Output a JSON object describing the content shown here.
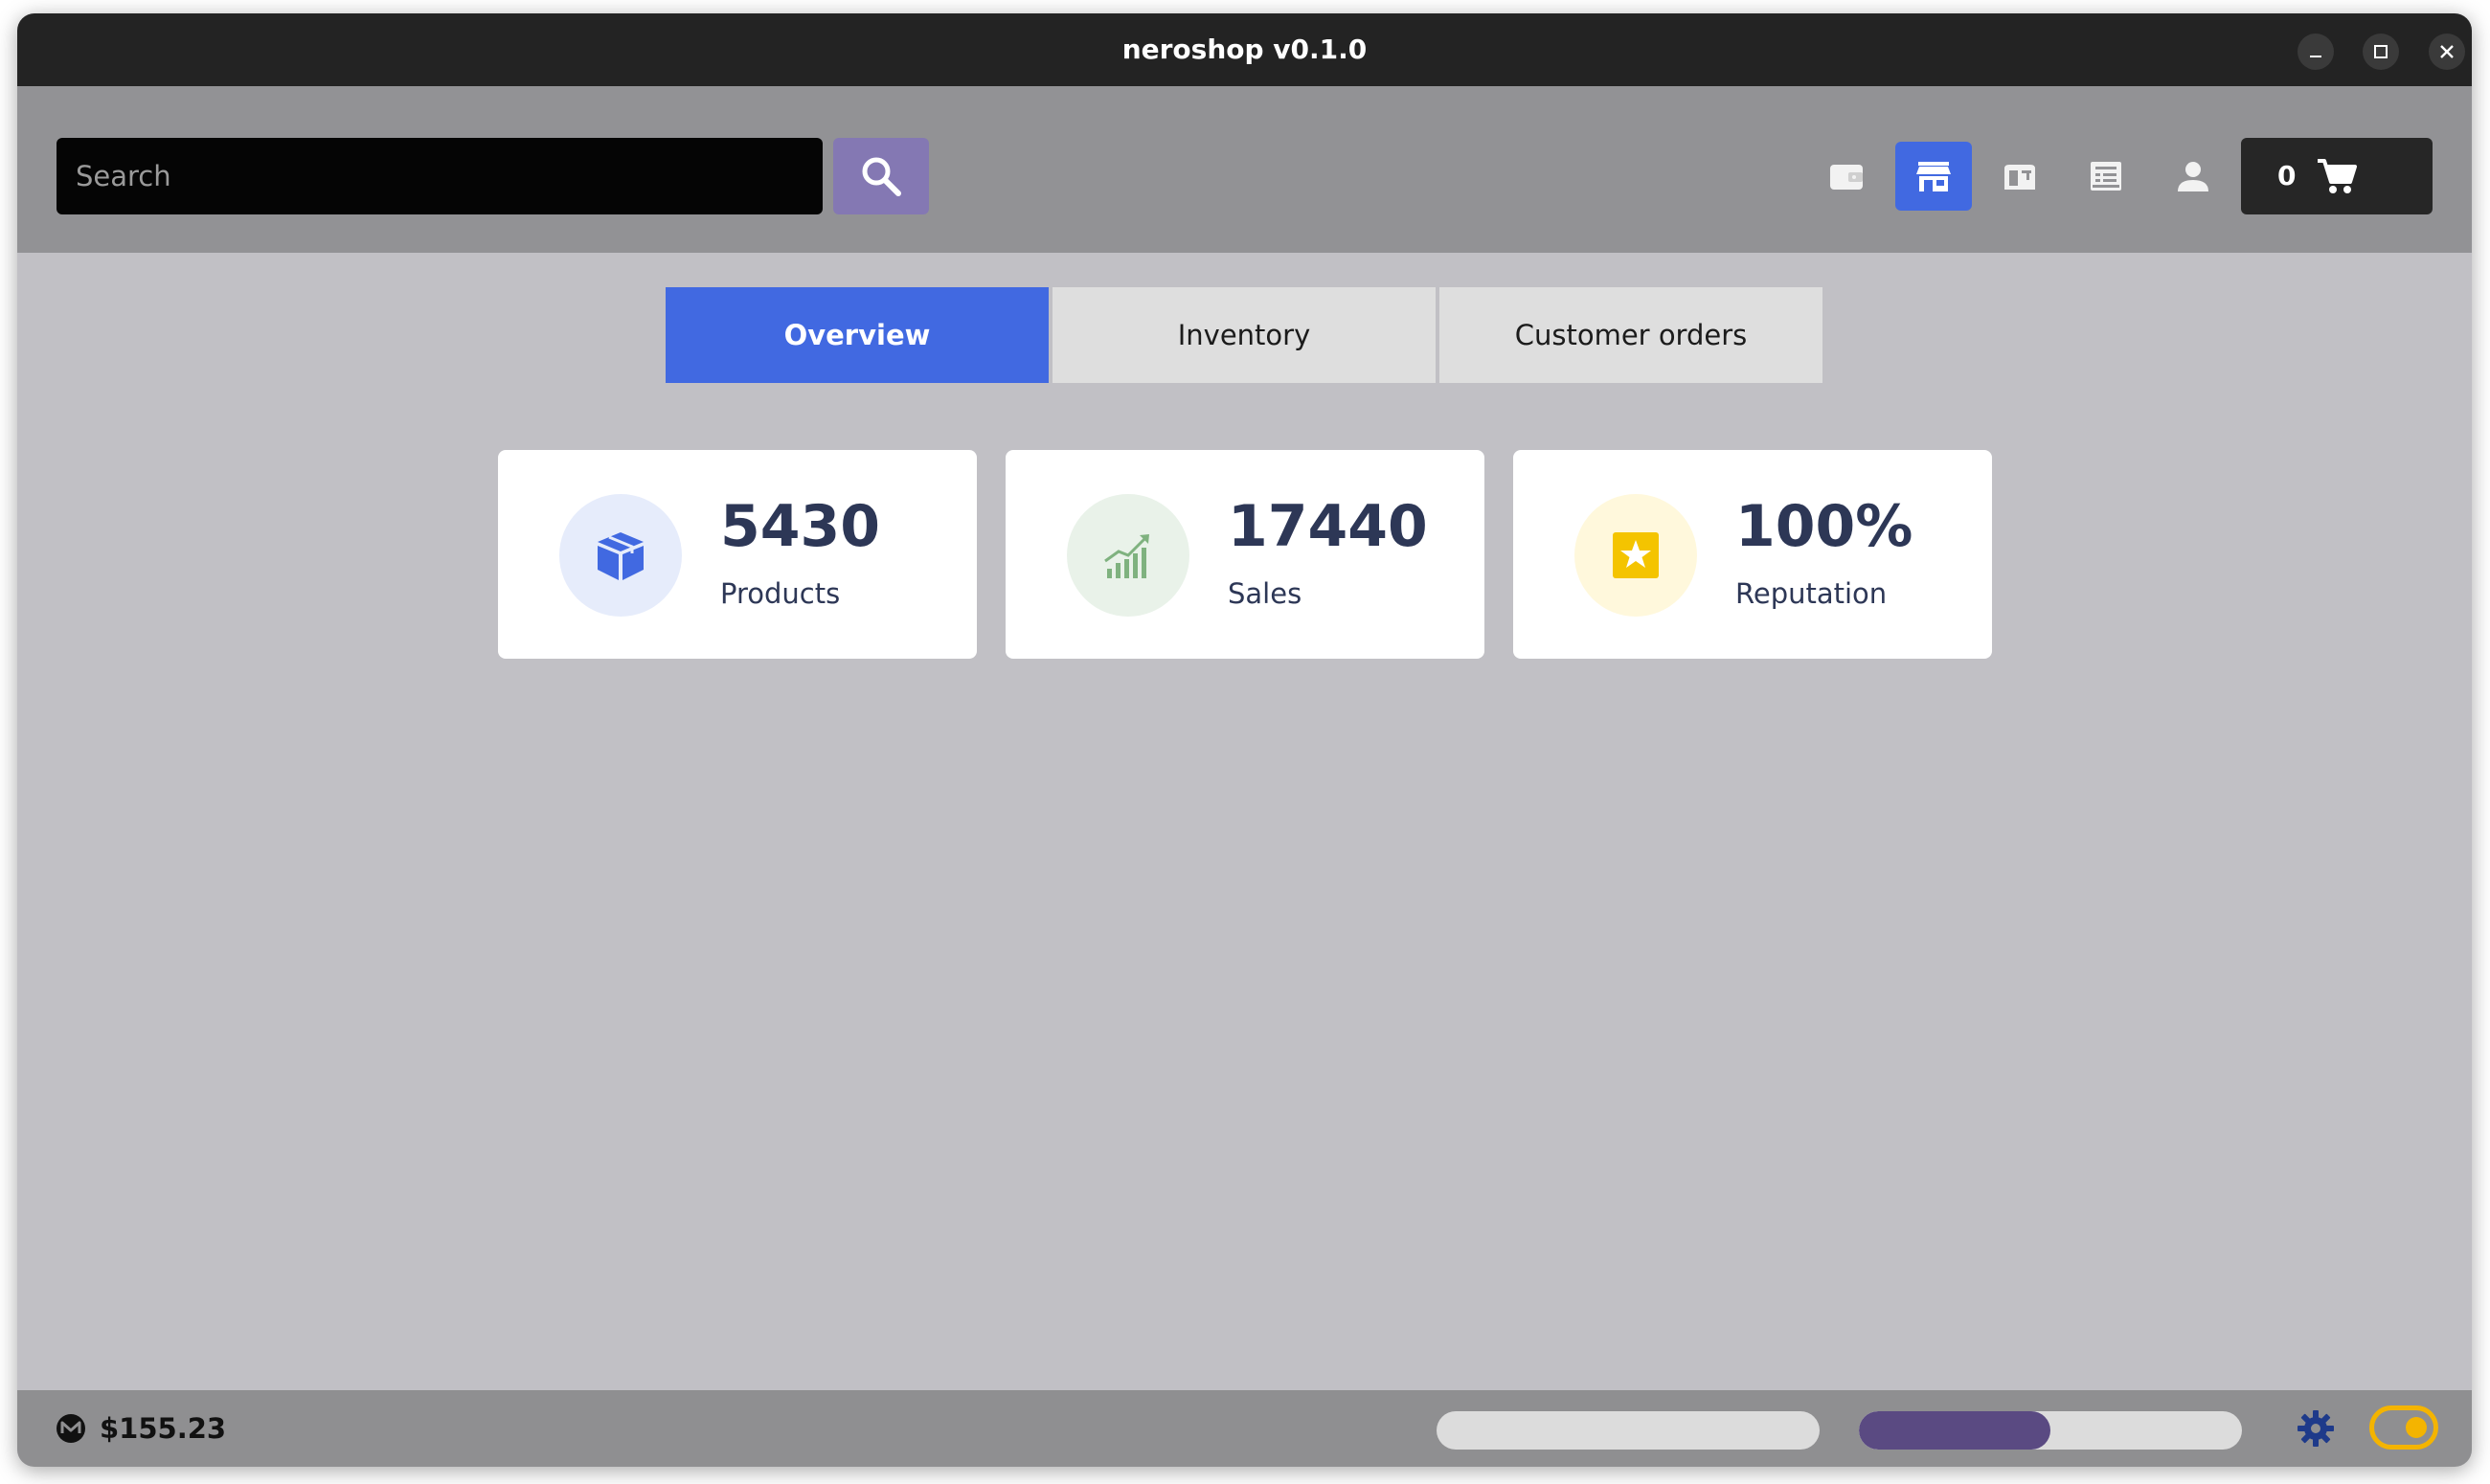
{
  "window": {
    "title": "neroshop v0.1.0",
    "controls": [
      "minimize-icon",
      "maximize-icon",
      "close-icon"
    ]
  },
  "toolbar": {
    "search": {
      "placeholder": "Search",
      "value": ""
    },
    "search_button_icon": "search-icon",
    "nav_icons": [
      "wallet-icon",
      "store-icon",
      "inbox-icon",
      "orders-icon",
      "user-icon"
    ],
    "active_nav": "store-icon",
    "cart": {
      "count": "0",
      "icon": "cart-icon"
    }
  },
  "tabs": [
    {
      "label": "Overview",
      "active": true
    },
    {
      "label": "Inventory",
      "active": false
    },
    {
      "label": "Customer orders",
      "active": false
    }
  ],
  "stats": [
    {
      "value": "5430",
      "label": "Products",
      "icon": "box-icon",
      "color": "#4169e1"
    },
    {
      "value": "17440",
      "label": "Sales",
      "icon": "trend-up-icon",
      "color": "#7fb27f"
    },
    {
      "value": "100%",
      "label": "Reputation",
      "icon": "star-icon",
      "color": "#f4c400"
    }
  ],
  "statusbar": {
    "currency_icon": "monero-icon",
    "balance": "$155.23",
    "progress_1": 0,
    "progress_2": 0.5,
    "settings_icon": "gear-icon",
    "theme_toggle_on": true
  },
  "colors": {
    "accent": "#4169e1",
    "search_button": "#8478b3",
    "progress_fill": "#5a4a82",
    "toggle": "#f4b400",
    "stat_text": "#2d3756"
  }
}
